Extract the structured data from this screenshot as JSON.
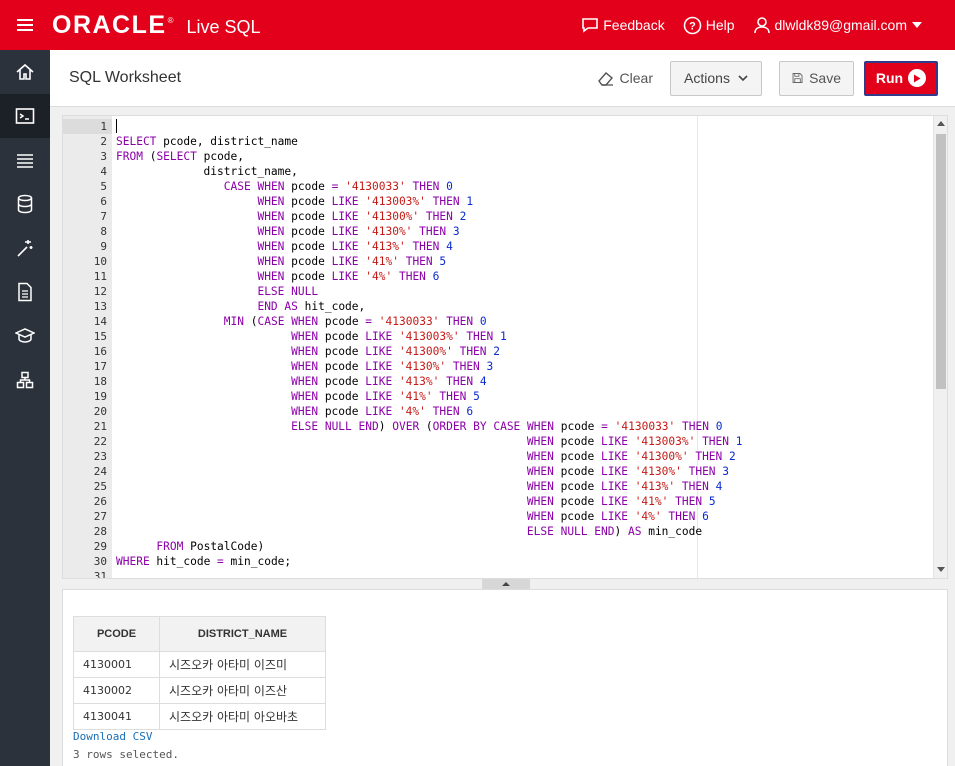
{
  "topbar": {
    "brand": "ORACLE",
    "product": "Live SQL",
    "feedback": "Feedback",
    "help": "Help",
    "user": "dlwldk89@gmail.com"
  },
  "nav": [
    "home-icon",
    "sql-worksheet-icon",
    "my-session-icon",
    "schema-icon",
    "quick-sql-icon",
    "my-scripts-icon",
    "code-library-icon",
    "sample-schemas-icon"
  ],
  "header": {
    "title": "SQL Worksheet",
    "clear": "Clear",
    "actions": "Actions",
    "save": "Save",
    "run": "Run"
  },
  "editor": {
    "lines": [
      "",
      "SELECT pcode, district_name",
      "FROM (SELECT pcode,",
      "             district_name,",
      "                CASE WHEN pcode = '4130033' THEN 0",
      "                     WHEN pcode LIKE '413003%' THEN 1",
      "                     WHEN pcode LIKE '41300%' THEN 2",
      "                     WHEN pcode LIKE '4130%' THEN 3",
      "                     WHEN pcode LIKE '413%' THEN 4",
      "                     WHEN pcode LIKE '41%' THEN 5",
      "                     WHEN pcode LIKE '4%' THEN 6",
      "                     ELSE NULL",
      "                     END AS hit_code,",
      "                MIN (CASE WHEN pcode = '4130033' THEN 0",
      "                          WHEN pcode LIKE '413003%' THEN 1",
      "                          WHEN pcode LIKE '41300%' THEN 2",
      "                          WHEN pcode LIKE '4130%' THEN 3",
      "                          WHEN pcode LIKE '413%' THEN 4",
      "                          WHEN pcode LIKE '41%' THEN 5",
      "                          WHEN pcode LIKE '4%' THEN 6",
      "                          ELSE NULL END) OVER (ORDER BY CASE WHEN pcode = '4130033' THEN 0",
      "                                                             WHEN pcode LIKE '413003%' THEN 1",
      "                                                             WHEN pcode LIKE '41300%' THEN 2",
      "                                                             WHEN pcode LIKE '4130%' THEN 3",
      "                                                             WHEN pcode LIKE '413%' THEN 4",
      "                                                             WHEN pcode LIKE '41%' THEN 5",
      "                                                             WHEN pcode LIKE '4%' THEN 6",
      "                                                             ELSE NULL END) AS min_code",
      "      FROM PostalCode)",
      "WHERE hit_code = min_code;",
      ""
    ]
  },
  "results": {
    "columns": [
      "PCODE",
      "DISTRICT_NAME"
    ],
    "rows": [
      [
        "4130001",
        "시즈오카 아타미 이즈미"
      ],
      [
        "4130002",
        "시즈오카 아타미 이즈산"
      ],
      [
        "4130041",
        "시즈오카 아타미 아오바초"
      ]
    ],
    "download": "Download CSV",
    "status": "3 rows selected."
  }
}
